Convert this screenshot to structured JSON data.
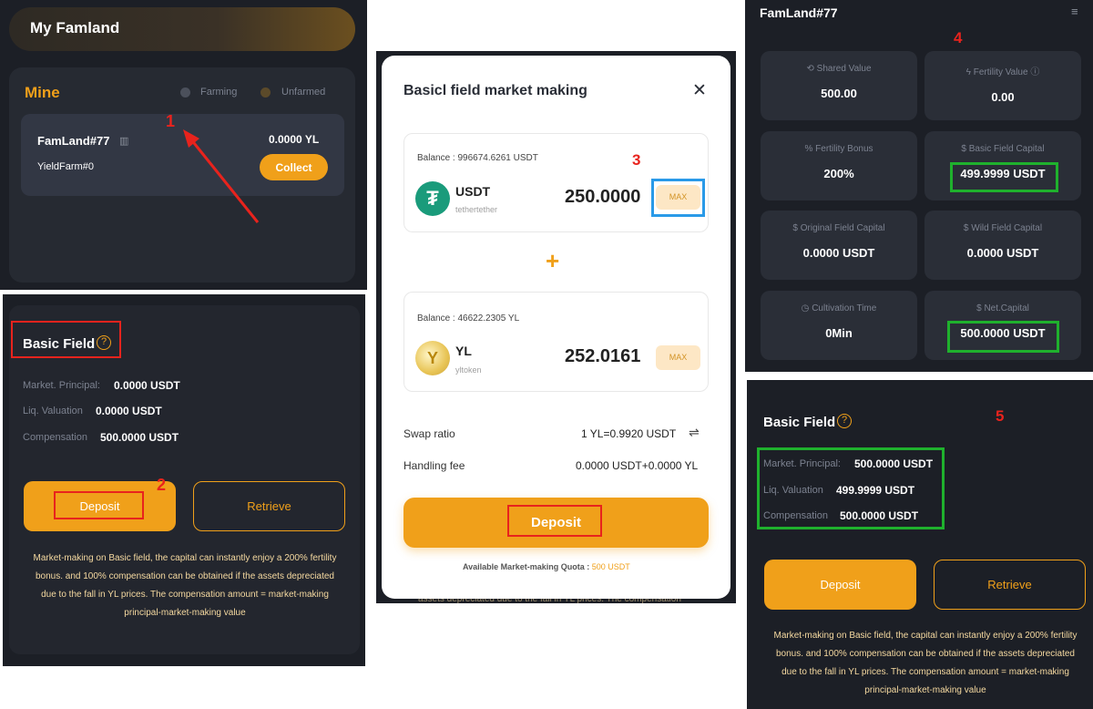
{
  "panel1": {
    "title": "My Famland",
    "section": "Mine",
    "legend_farming": "Farming",
    "legend_unfarmed": "Unfarmed",
    "farm_name": "FamLand#77",
    "farm_sub": "YieldFarm#0",
    "farm_amount": "0.0000 YL",
    "collect_label": "Collect",
    "marker": "1"
  },
  "panel2": {
    "title": "Basic Field",
    "rows": [
      {
        "label": "Market. Principal:",
        "value": "0.0000 USDT"
      },
      {
        "label": "Liq. Valuation",
        "value": "0.0000 USDT"
      },
      {
        "label": "Compensation",
        "value": "500.0000 USDT"
      }
    ],
    "deposit_label": "Deposit",
    "retrieve_label": "Retrieve",
    "note": "Market-making on Basic field, the capital can instantly enjoy a 200% fertility bonus. and 100% compensation can be obtained if the assets depreciated due to the fall in YL prices. The compensation amount = market-making principal-market-making value",
    "marker": "2"
  },
  "modal": {
    "title": "Basicl field market making",
    "close": "✕",
    "usdt": {
      "balance": "Balance : 996674.6261 USDT",
      "symbol": "USDT",
      "name": "tethertether",
      "amount": "250.0000",
      "max": "MAX"
    },
    "plus": "+",
    "yl": {
      "balance": "Balance : 46622.2305 YL",
      "symbol": "YL",
      "name": "yltoken",
      "amount": "252.0161",
      "max": "MAX"
    },
    "swap_label": "Swap ratio",
    "swap_value": "1 YL=0.9920 USDT",
    "fee_label": "Handling fee",
    "fee_value": "0.0000 USDT+0.0000 YL",
    "deposit_label": "Deposit",
    "quota_label": "Available Market-making Quota :",
    "quota_value": "500 USDT",
    "behind_text": "assets depreciated due to the fall in YL prices. The compensation",
    "marker": "3"
  },
  "panel4": {
    "title": "FamLand#77",
    "marker": "4",
    "stats": [
      {
        "label": "Shared Value",
        "value": "500.00",
        "icon": "share-icon"
      },
      {
        "label": "Fertility Value",
        "value": "0.00",
        "icon": "fertility-icon"
      },
      {
        "label": "Fertility Bonus",
        "value": "200%",
        "icon": "percent-icon"
      },
      {
        "label": "Basic Field Capital",
        "value": "499.9999 USDT",
        "icon": "dollar-icon"
      },
      {
        "label": "Original Field Capital",
        "value": "0.0000 USDT",
        "icon": "dollar-icon"
      },
      {
        "label": "Wild Field Capital",
        "value": "0.0000 USDT",
        "icon": "dollar-icon"
      },
      {
        "label": "Cultivation Time",
        "value": "0Min",
        "icon": "clock-icon"
      },
      {
        "label": "Net.Capital",
        "value": "500.0000 USDT",
        "icon": "dollar-icon"
      }
    ]
  },
  "panel5": {
    "title": "Basic Field",
    "marker": "5",
    "rows": [
      {
        "label": "Market. Principal:",
        "value": "500.0000 USDT"
      },
      {
        "label": "Liq. Valuation",
        "value": "499.9999 USDT"
      },
      {
        "label": "Compensation",
        "value": "500.0000 USDT"
      }
    ],
    "deposit_label": "Deposit",
    "retrieve_label": "Retrieve",
    "note": "Market-making on Basic field, the capital can instantly enjoy a 200% fertility bonus. and 100% compensation can be obtained if the assets depreciated due to the fall in YL prices. The compensation amount = market-making principal-market-making value"
  }
}
